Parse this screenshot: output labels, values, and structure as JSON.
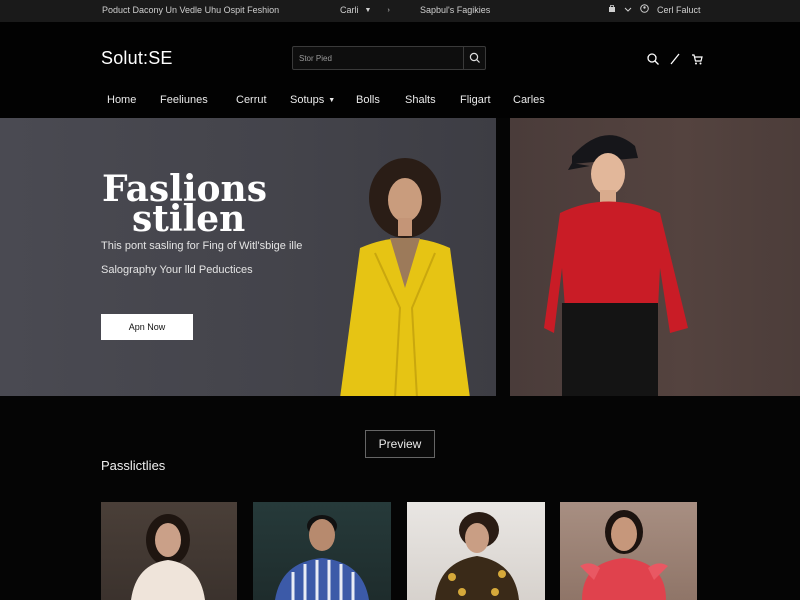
{
  "topbar": {
    "promo": "Poduct Dacony Un Vedle Uhu Ospit Feshion",
    "currency": "Carli",
    "link": "Sapbul's Fagikies",
    "account": "Cerl Faluct"
  },
  "header": {
    "logo": "Solut:SE",
    "search_placeholder": "Stor Pied",
    "nav": [
      "Home",
      "Feeliunes",
      "Cerrut",
      "Sotups",
      "Bolls",
      "Shalts",
      "Fligart",
      "Carles"
    ]
  },
  "hero": {
    "title_line1": "Faslions",
    "title_line2": "stilen",
    "subtitle1": "This pont sasling for Fing of Witl'sbige ille",
    "subtitle2": "Salography Your lld Peductices",
    "cta_label": "Apn Now"
  },
  "section": {
    "preview_label": "Preview",
    "title": "Passlictlies"
  },
  "products": [
    {
      "name": "product-card-1"
    },
    {
      "name": "product-card-2"
    },
    {
      "name": "product-card-3"
    },
    {
      "name": "product-card-4"
    }
  ],
  "colors": {
    "accent_yellow": "#e8c415",
    "accent_red": "#c91c26"
  }
}
